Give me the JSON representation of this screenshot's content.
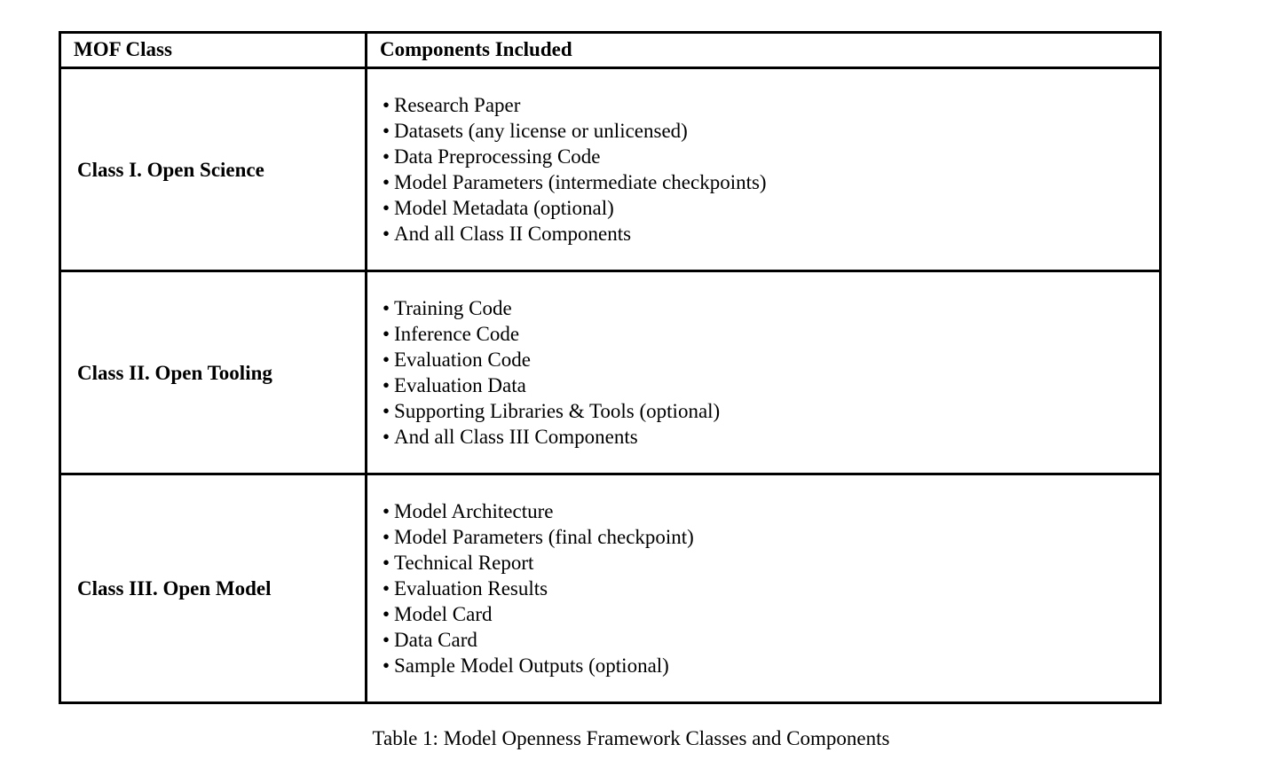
{
  "table": {
    "columns": [
      {
        "header": "MOF Class"
      },
      {
        "header": "Components Included"
      }
    ],
    "rows": [
      {
        "class_name": "Class I. Open Science",
        "components": [
          "Research Paper",
          "Datasets (any license or unlicensed)",
          "Data Preprocessing Code",
          "Model Parameters (intermediate checkpoints)",
          "Model Metadata (optional)",
          "And all Class II Components"
        ]
      },
      {
        "class_name": "Class II. Open Tooling",
        "components": [
          "Training Code",
          "Inference Code",
          "Evaluation Code",
          "Evaluation Data",
          "Supporting Libraries & Tools (optional)",
          "And all Class III Components"
        ]
      },
      {
        "class_name": "Class III. Open Model",
        "components": [
          "Model Architecture",
          "Model Parameters (final checkpoint)",
          "Technical Report",
          "Evaluation Results",
          "Model Card",
          "Data Card",
          "Sample Model Outputs (optional)"
        ]
      }
    ]
  },
  "caption": {
    "label": "Table 1:",
    "separator": " ",
    "text": "Model Openness Framework Classes and Components",
    "full": "Table 1:  Model Openness Framework Classes and Components"
  },
  "bullet_glyph": "•",
  "colors": {
    "text": "#000000",
    "background": "#ffffff",
    "border": "#000000"
  }
}
